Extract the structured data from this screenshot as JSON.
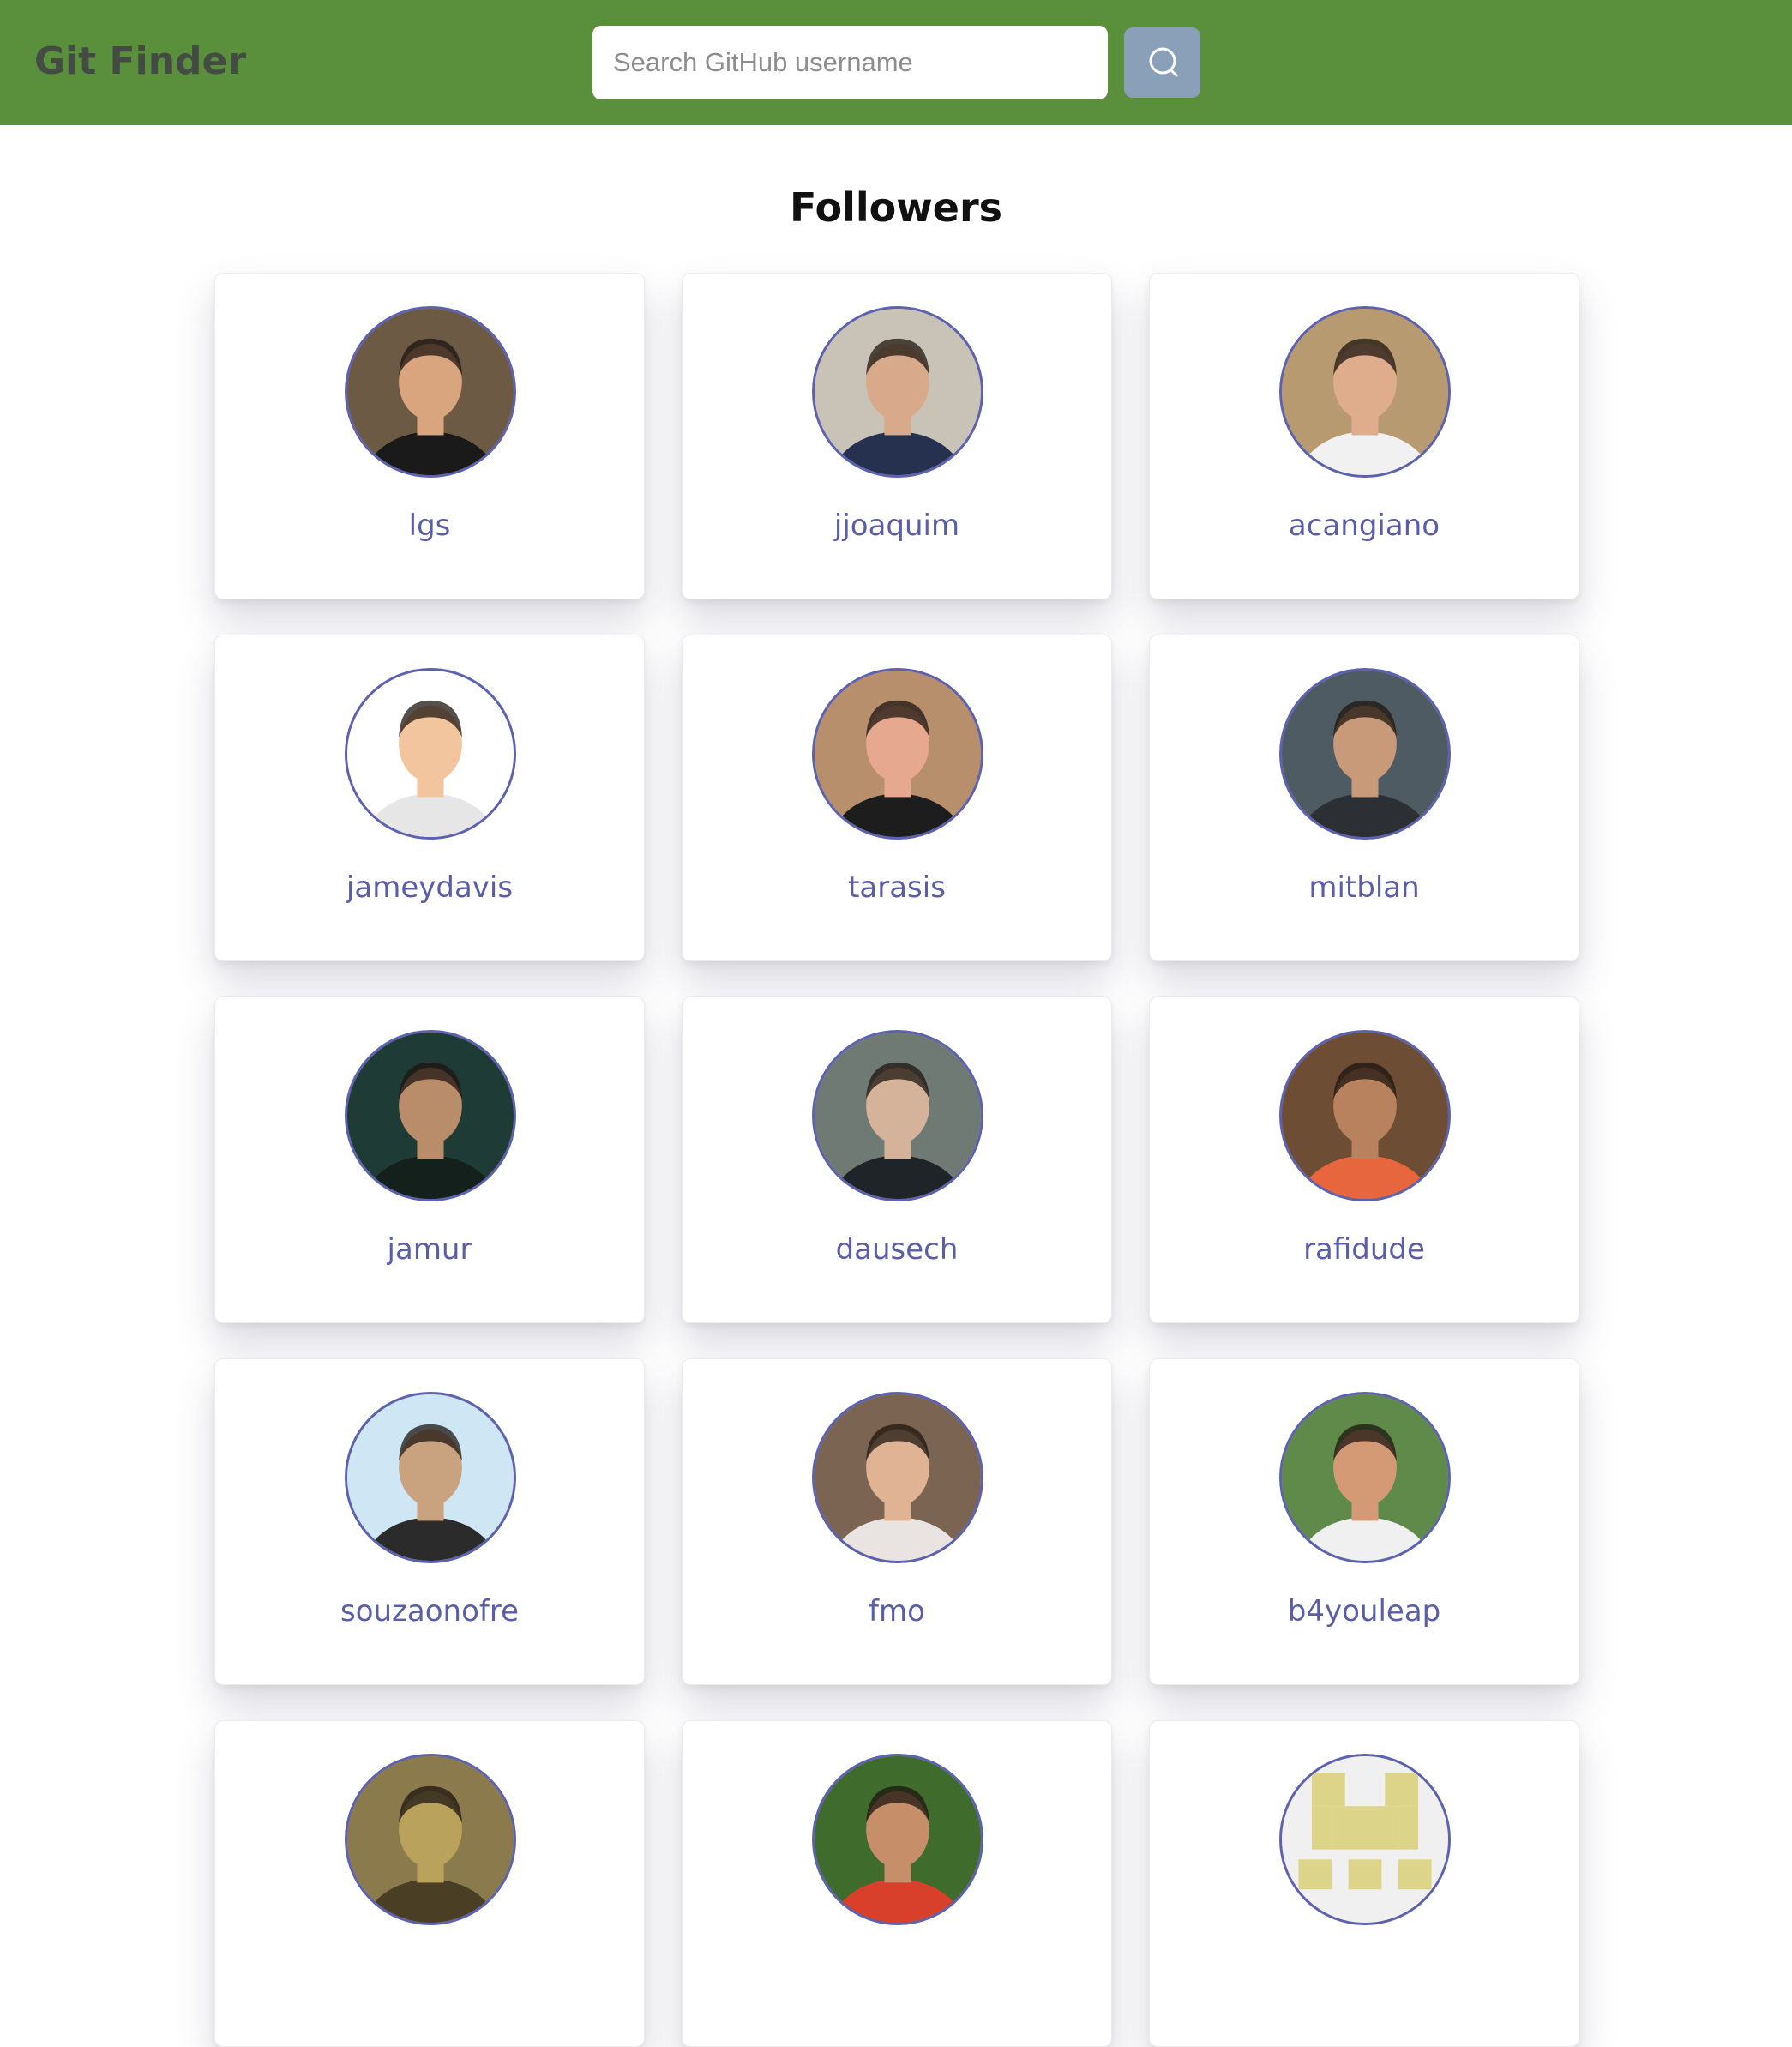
{
  "navbar": {
    "brand": "Git Finder",
    "search": {
      "placeholder": "Search GitHub username",
      "value": ""
    },
    "search_button_icon": "search-icon"
  },
  "main": {
    "heading": "Followers",
    "followers": [
      {
        "username": "lgs",
        "avatar_bg": "#6d5a45",
        "avatar_skin": "#d9a57e",
        "avatar_shirt": "#1a1a1a"
      },
      {
        "username": "jjoaquim",
        "avatar_bg": "#c9c2b6",
        "avatar_skin": "#d8a98a",
        "avatar_shirt": "#26304f"
      },
      {
        "username": "acangiano",
        "avatar_bg": "#b89a70",
        "avatar_skin": "#e0ad8c",
        "avatar_shirt": "#f1f1f1"
      },
      {
        "username": "jameydavis",
        "avatar_bg": "#ffffff",
        "avatar_skin": "#f2c59e",
        "avatar_shirt": "#e6e6e6"
      },
      {
        "username": "tarasis",
        "avatar_bg": "#b88f6c",
        "avatar_skin": "#e7a890",
        "avatar_shirt": "#1d1d1d"
      },
      {
        "username": "mitblan",
        "avatar_bg": "#4f5b63",
        "avatar_skin": "#c99a7a",
        "avatar_shirt": "#2c2f33"
      },
      {
        "username": "jamur",
        "avatar_bg": "#1f3b35",
        "avatar_skin": "#b98c6a",
        "avatar_shirt": "#14201c"
      },
      {
        "username": "dausech",
        "avatar_bg": "#6f7a75",
        "avatar_skin": "#d5b39b",
        "avatar_shirt": "#1f2428"
      },
      {
        "username": "rafidude",
        "avatar_bg": "#6d4d34",
        "avatar_skin": "#b9825e",
        "avatar_shirt": "#e8663e"
      },
      {
        "username": "souzaonofre",
        "avatar_bg": "#cfe6f5",
        "avatar_skin": "#c9a27f",
        "avatar_shirt": "#2b2b2b"
      },
      {
        "username": "fmo",
        "avatar_bg": "#7b6552",
        "avatar_skin": "#dfb394",
        "avatar_shirt": "#e9e3e1"
      },
      {
        "username": "b4youleap",
        "avatar_bg": "#5f8a4a",
        "avatar_skin": "#d49a76",
        "avatar_shirt": "#f0f0f0"
      },
      {
        "username": "",
        "avatar_bg": "#8a7a4c",
        "avatar_skin": "#b9a35c",
        "avatar_shirt": "#4a3f24"
      },
      {
        "username": "",
        "avatar_bg": "#3f6b2c",
        "avatar_skin": "#c78e6a",
        "avatar_shirt": "#d8402c"
      },
      {
        "username": "",
        "avatar_bg": "#f0f0f0",
        "avatar_skin": "#dcd488",
        "avatar_shirt": "#dcd488",
        "identicon": true
      }
    ]
  },
  "colors": {
    "navbar": "#5a8f3c",
    "brand": "#444a44",
    "search_button": "#8aa0b9",
    "username": "#5b5ea6",
    "avatar_border": "#5c62b0"
  }
}
